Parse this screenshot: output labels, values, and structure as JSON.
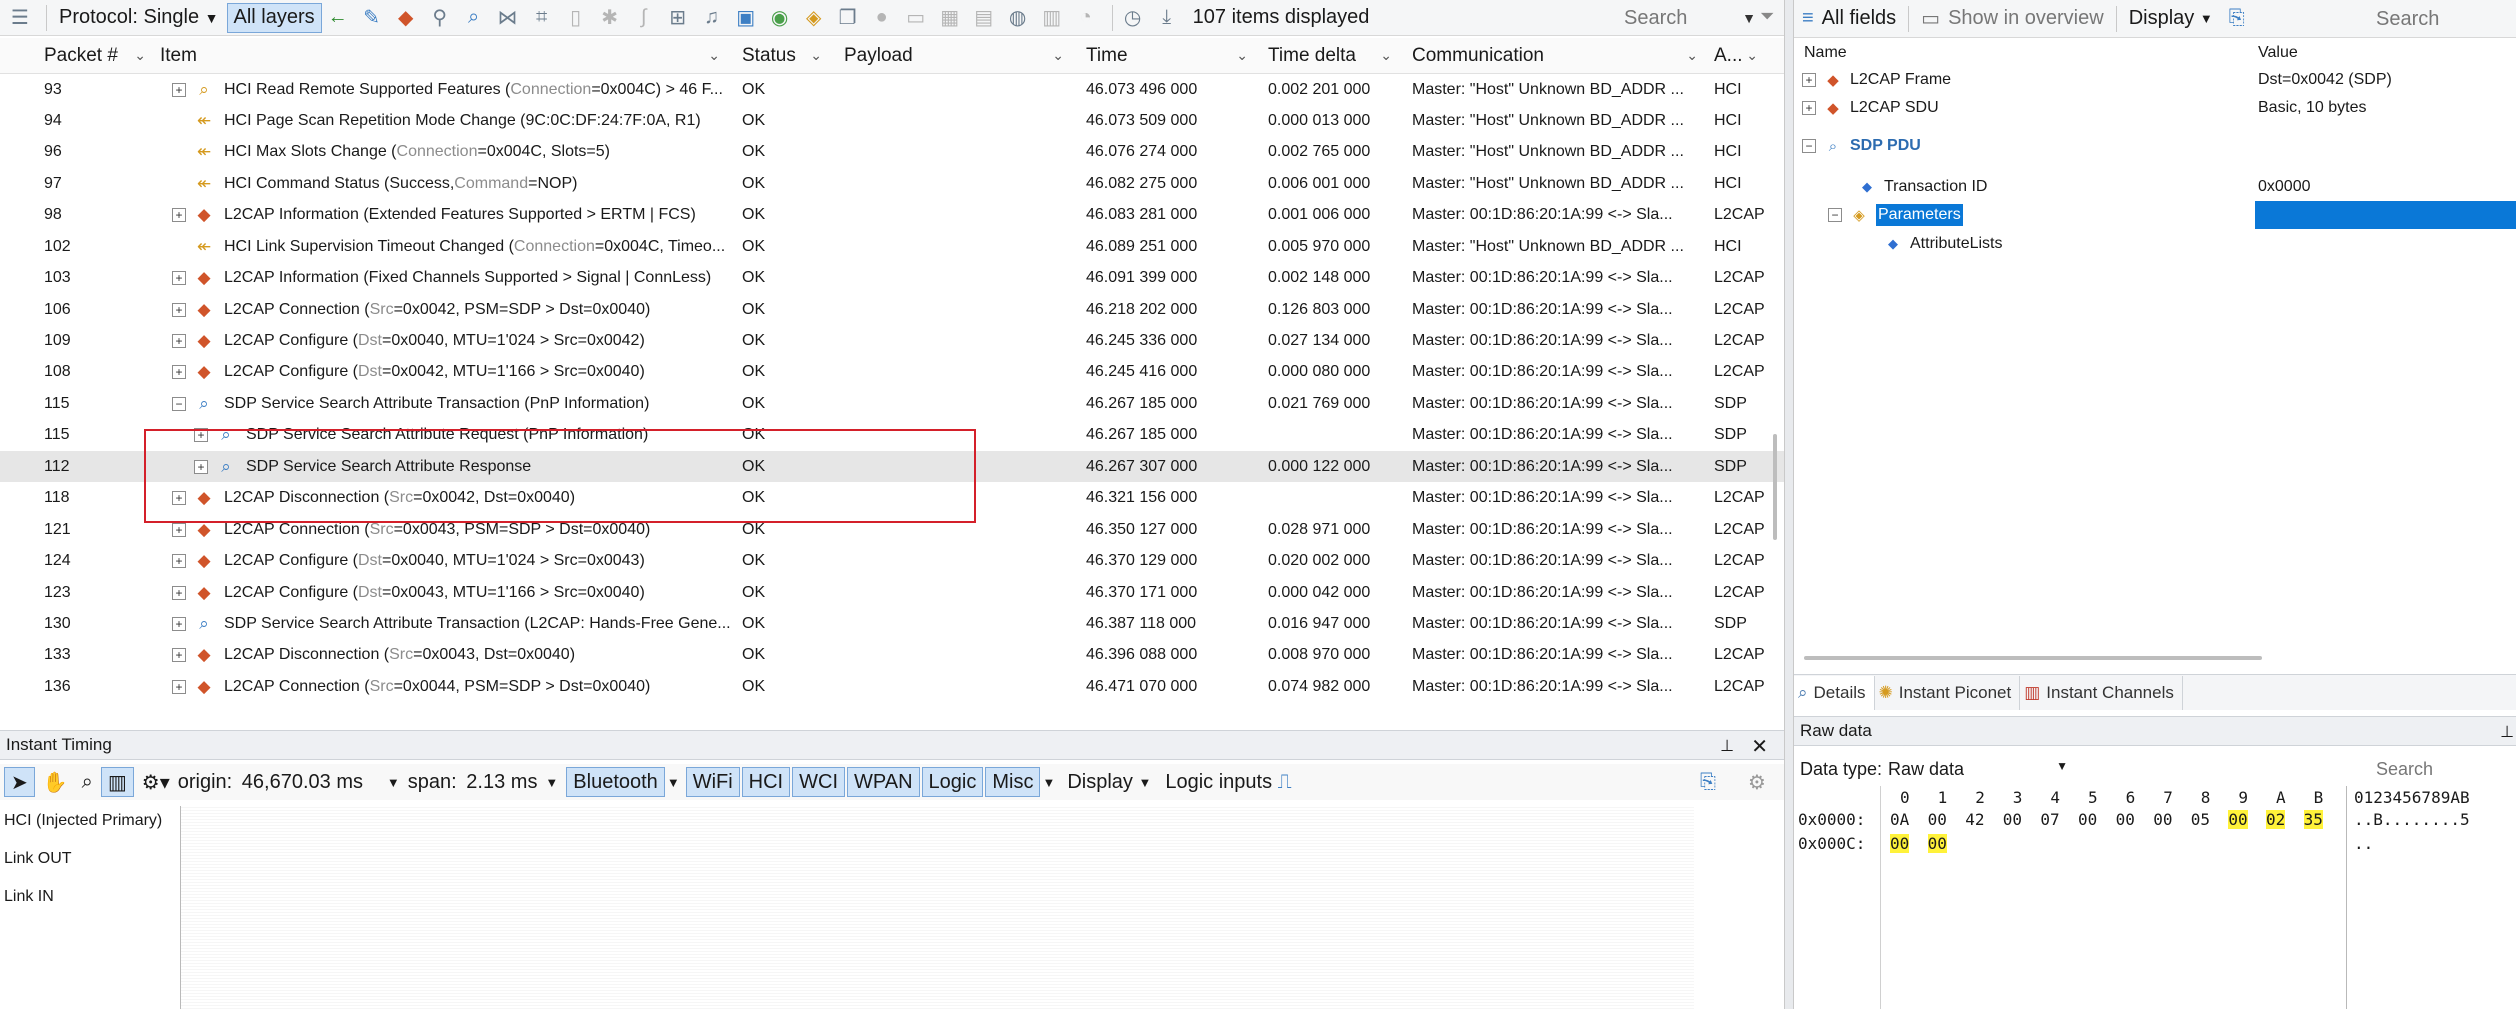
{
  "toolbar": {
    "protocol_label": "Protocol: Single",
    "all_layers_label": "All layers",
    "items_displayed": "107 items displayed",
    "search_label": "Search"
  },
  "columns": {
    "packet": "Packet #",
    "item": "Item",
    "status": "Status",
    "payload": "Payload",
    "time": "Time",
    "time_delta": "Time delta",
    "communication": "Communication",
    "app": "A..."
  },
  "rows": [
    {
      "packet": "93",
      "expander": "+",
      "icon": "hci",
      "item": "HCI Read Remote Supported Features (",
      "item_dim": "Connection",
      "item_rest": "=0x004C) > 46 F...",
      "status": "OK",
      "time": "46.073 496 000",
      "delta": "0.002 201 000",
      "comm": "Master: \"Host\" Unknown BD_ADDR ...",
      "app": "HCI"
    },
    {
      "packet": "94",
      "expander": "",
      "icon": "hci-ev",
      "item": "HCI Page Scan Repetition Mode Change (9C:0C:DF:24:7F:0A, R1)",
      "item_dim": "",
      "item_rest": "",
      "status": "OK",
      "time": "46.073 509 000",
      "delta": "0.000 013 000",
      "comm": "Master: \"Host\" Unknown BD_ADDR ...",
      "app": "HCI"
    },
    {
      "packet": "96",
      "expander": "",
      "icon": "hci-ev",
      "item": "HCI Max Slots Change (",
      "item_dim": "Connection",
      "item_rest": "=0x004C, Slots=5)",
      "status": "OK",
      "time": "46.076 274 000",
      "delta": "0.002 765 000",
      "comm": "Master: \"Host\" Unknown BD_ADDR ...",
      "app": "HCI"
    },
    {
      "packet": "97",
      "expander": "",
      "icon": "hci-ev",
      "item": "HCI Command Status (Success, ",
      "item_dim": "Command",
      "item_rest": "=NOP)",
      "status": "OK",
      "time": "46.082 275 000",
      "delta": "0.006 001 000",
      "comm": "Master: \"Host\" Unknown BD_ADDR ...",
      "app": "HCI"
    },
    {
      "packet": "98",
      "expander": "+",
      "icon": "l2",
      "item": "L2CAP Information (Extended Features Supported > ERTM | FCS)",
      "item_dim": "",
      "item_rest": "",
      "status": "OK",
      "time": "46.083 281 000",
      "delta": "0.001 006 000",
      "comm": "Master: 00:1D:86:20:1A:99 <-> Sla...",
      "app": "L2CAP"
    },
    {
      "packet": "102",
      "expander": "",
      "icon": "hci-ev",
      "item": "HCI Link Supervision Timeout Changed (",
      "item_dim": "Connection",
      "item_rest": "=0x004C, Timeo...",
      "status": "OK",
      "time": "46.089 251 000",
      "delta": "0.005 970 000",
      "comm": "Master: \"Host\" Unknown BD_ADDR ...",
      "app": "HCI"
    },
    {
      "packet": "103",
      "expander": "+",
      "icon": "l2",
      "item": "L2CAP Information (Fixed Channels Supported > Signal | ConnLess)",
      "item_dim": "",
      "item_rest": "",
      "status": "OK",
      "time": "46.091 399 000",
      "delta": "0.002 148 000",
      "comm": "Master: 00:1D:86:20:1A:99 <-> Sla...",
      "app": "L2CAP"
    },
    {
      "packet": "106",
      "expander": "+",
      "icon": "l2",
      "item": "L2CAP Connection (",
      "item_dim": "Src",
      "item_rest": "=0x0042, PSM=SDP > Dst=0x0040)",
      "status": "OK",
      "time": "46.218 202 000",
      "delta": "0.126 803 000",
      "comm": "Master: 00:1D:86:20:1A:99 <-> Sla...",
      "app": "L2CAP"
    },
    {
      "packet": "109",
      "expander": "+",
      "icon": "l2",
      "item": "L2CAP Configure (",
      "item_dim": "Dst",
      "item_rest": "=0x0040, MTU=1'024 > Src=0x0042)",
      "status": "OK",
      "time": "46.245 336 000",
      "delta": "0.027 134 000",
      "comm": "Master: 00:1D:86:20:1A:99 <-> Sla...",
      "app": "L2CAP"
    },
    {
      "packet": "108",
      "expander": "+",
      "icon": "l2",
      "item": "L2CAP Configure (",
      "item_dim": "Dst",
      "item_rest": "=0x0042, MTU=1'166 > Src=0x0040)",
      "status": "OK",
      "time": "46.245 416 000",
      "delta": "0.000 080 000",
      "comm": "Master: 00:1D:86:20:1A:99 <-> Sla...",
      "app": "L2CAP"
    },
    {
      "packet": "115",
      "expander": "−",
      "icon": "sdp",
      "item": "SDP Service Search Attribute Transaction (PnP Information)",
      "item_dim": "",
      "item_rest": "",
      "status": "OK",
      "time": "46.267 185 000",
      "delta": "0.021 769 000",
      "comm": "Master: 00:1D:86:20:1A:99 <-> Sla...",
      "app": "SDP"
    },
    {
      "packet": "115",
      "expander": "+",
      "icon": "sdp",
      "indent": true,
      "item": "SDP Service Search Attribute Request (PnP Information)",
      "item_dim": "",
      "item_rest": "",
      "status": "OK",
      "time": "46.267 185 000",
      "delta": "",
      "comm": "Master: 00:1D:86:20:1A:99 <-> Sla...",
      "app": "SDP"
    },
    {
      "packet": "112",
      "expander": "+",
      "icon": "sdp",
      "indent": true,
      "selected": true,
      "item": "SDP Service Search Attribute Response",
      "item_dim": "",
      "item_rest": "",
      "status": "OK",
      "time": "46.267 307 000",
      "delta": "0.000 122 000",
      "comm": "Master: 00:1D:86:20:1A:99 <-> Sla...",
      "app": "SDP"
    },
    {
      "packet": "118",
      "expander": "+",
      "icon": "l2",
      "item": "L2CAP Disconnection (",
      "item_dim": "Src",
      "item_rest": "=0x0042, Dst=0x0040)",
      "status": "OK",
      "time": "46.321 156 000",
      "delta": "",
      "comm": "Master: 00:1D:86:20:1A:99 <-> Sla...",
      "app": "L2CAP"
    },
    {
      "packet": "121",
      "expander": "+",
      "icon": "l2",
      "item": "L2CAP Connection (",
      "item_dim": "Src",
      "item_rest": "=0x0043, PSM=SDP > Dst=0x0040)",
      "status": "OK",
      "time": "46.350 127 000",
      "delta": "0.028 971 000",
      "comm": "Master: 00:1D:86:20:1A:99 <-> Sla...",
      "app": "L2CAP"
    },
    {
      "packet": "124",
      "expander": "+",
      "icon": "l2",
      "item": "L2CAP Configure (",
      "item_dim": "Dst",
      "item_rest": "=0x0040, MTU=1'024 > Src=0x0043)",
      "status": "OK",
      "time": "46.370 129 000",
      "delta": "0.020 002 000",
      "comm": "Master: 00:1D:86:20:1A:99 <-> Sla...",
      "app": "L2CAP"
    },
    {
      "packet": "123",
      "expander": "+",
      "icon": "l2",
      "item": "L2CAP Configure (",
      "item_dim": "Dst",
      "item_rest": "=0x0043, MTU=1'166 > Src=0x0040)",
      "status": "OK",
      "time": "46.370 171 000",
      "delta": "0.000 042 000",
      "comm": "Master: 00:1D:86:20:1A:99 <-> Sla...",
      "app": "L2CAP"
    },
    {
      "packet": "130",
      "expander": "+",
      "icon": "sdp",
      "item": "SDP Service Search Attribute Transaction (L2CAP: Hands-Free Gene...",
      "item_dim": "",
      "item_rest": "",
      "status": "OK",
      "time": "46.387 118 000",
      "delta": "0.016 947 000",
      "comm": "Master: 00:1D:86:20:1A:99 <-> Sla...",
      "app": "SDP"
    },
    {
      "packet": "133",
      "expander": "+",
      "icon": "l2",
      "item": "L2CAP Disconnection (",
      "item_dim": "Src",
      "item_rest": "=0x0043, Dst=0x0040)",
      "status": "OK",
      "time": "46.396 088 000",
      "delta": "0.008 970 000",
      "comm": "Master: 00:1D:86:20:1A:99 <-> Sla...",
      "app": "L2CAP"
    },
    {
      "packet": "136",
      "expander": "+",
      "icon": "l2",
      "item": "L2CAP Connection (",
      "item_dim": "Src",
      "item_rest": "=0x0044, PSM=SDP > Dst=0x0040)",
      "status": "OK",
      "time": "46.471 070 000",
      "delta": "0.074 982 000",
      "comm": "Master: 00:1D:86:20:1A:99 <-> Sla...",
      "app": "L2CAP"
    }
  ],
  "timing": {
    "title": "Instant Timing",
    "origin_label": "origin:",
    "origin_value": "46,670.03 ms",
    "span_label": "span:",
    "span_value": "2.13 ms",
    "filters": [
      "Bluetooth",
      "WiFi",
      "HCI",
      "WCI",
      "WPAN",
      "Logic",
      "Misc"
    ],
    "display_label": "Display",
    "logic_inputs_label": "Logic inputs",
    "tracks": [
      "HCI (Injected Primary)",
      "Link OUT",
      "Link IN"
    ]
  },
  "details_toolbar": {
    "all_fields": "All fields",
    "show_in_overview": "Show in overview",
    "display": "Display",
    "search": "Search"
  },
  "tree": {
    "name_header": "Name",
    "value_header": "Value",
    "items": [
      {
        "name": "L2CAP Frame",
        "value": "Dst=0x0042 (SDP)"
      },
      {
        "name": "L2CAP SDU",
        "value": "Basic, 10 bytes"
      },
      {
        "name": "SDP PDU",
        "value": ""
      },
      {
        "name": "Transaction ID",
        "value": "0x0000"
      },
      {
        "name": "Parameters",
        "value": ""
      },
      {
        "name": "AttributeLists",
        "value": ""
      }
    ]
  },
  "tabs": [
    "Details",
    "Instant Piconet",
    "Instant Channels"
  ],
  "raw": {
    "title": "Raw data",
    "type_label": "Data type:",
    "type_value": "Raw data",
    "search": "Search",
    "col_header": [
      "0",
      "1",
      "2",
      "3",
      "4",
      "5",
      "6",
      "7",
      "8",
      "9",
      "A",
      "B"
    ],
    "ascii_header": "0123456789AB",
    "lines": [
      {
        "offset": "0x0000:",
        "bytes": [
          "0A",
          "00",
          "42",
          "00",
          "07",
          "00",
          "00",
          "00",
          "05",
          "00",
          "02",
          "35"
        ],
        "highlight_from": 9,
        "ascii": "..B........5"
      },
      {
        "offset": "0x000C:",
        "bytes": [
          "00",
          "00"
        ],
        "highlight_from": 0,
        "ascii": ".."
      }
    ]
  },
  "colors": {
    "accent": "#0a78d7",
    "highlight_box": "#d4202a",
    "hex_highlight": "#fff23a"
  }
}
